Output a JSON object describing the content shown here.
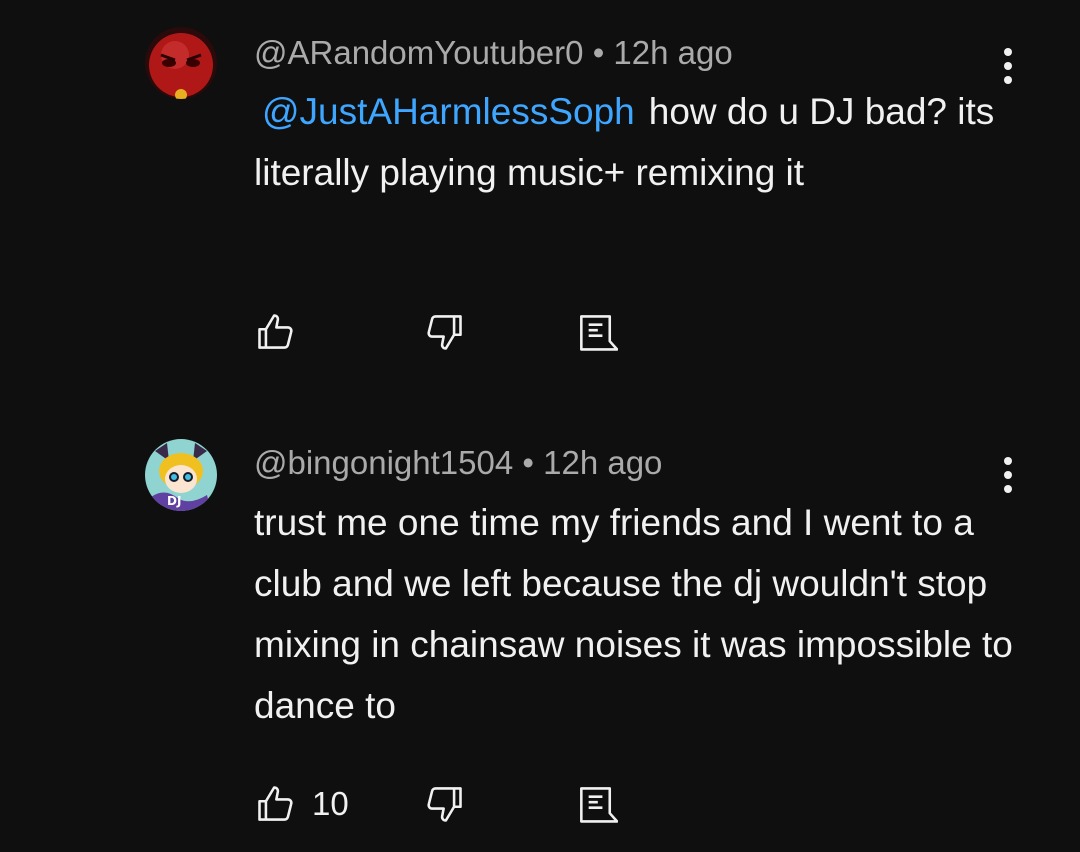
{
  "comments": [
    {
      "author": "@ARandomYoutuber0",
      "separator": "•",
      "time": "12h ago",
      "mention": "@JustAHarmlessSoph",
      "text": "how do u DJ bad? its literally playing music+ remixing it",
      "likes": "",
      "avatar_icon": "red-face-avatar"
    },
    {
      "author": "@bingonight1504",
      "separator": "•",
      "time": "12h ago",
      "mention": "",
      "text": "trust me one time my friends and I went to a club and we left because the dj wouldn't stop mixing in chainsaw noises it was impossible to dance to",
      "likes": "10",
      "avatar_icon": "anime-character-avatar"
    }
  ],
  "icons": {
    "like": "thumbs-up-icon",
    "dislike": "thumbs-down-icon",
    "reply": "reply-comment-icon",
    "more": "more-vertical-icon"
  },
  "colors": {
    "background": "#0f0f0f",
    "text": "#f1f1f1",
    "meta": "#aaaaaa",
    "mention": "#3ea6ff"
  }
}
